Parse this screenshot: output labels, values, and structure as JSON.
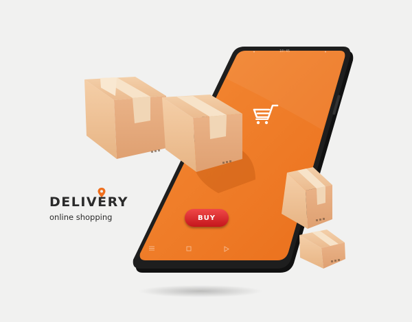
{
  "brand": {
    "title": "DELIVERY",
    "subtitle": "online shopping",
    "pin_icon": "location-pin-icon"
  },
  "phone": {
    "status_time": "10:45",
    "screen_icon": "shopping-cart-icon",
    "buy_label": "BUY",
    "nav_icons": [
      "menu-icon",
      "home-square-icon",
      "back-triangle-icon"
    ]
  },
  "colors": {
    "background": "#f1f1f0",
    "screen_orange": "#f07a24",
    "phone_frame": "#1e1e1e",
    "buy_button": "#e02a2a",
    "box_cardboard": "#e9b589",
    "pin": "#ef6f1e"
  },
  "decor": {
    "parcel_count": 4
  }
}
